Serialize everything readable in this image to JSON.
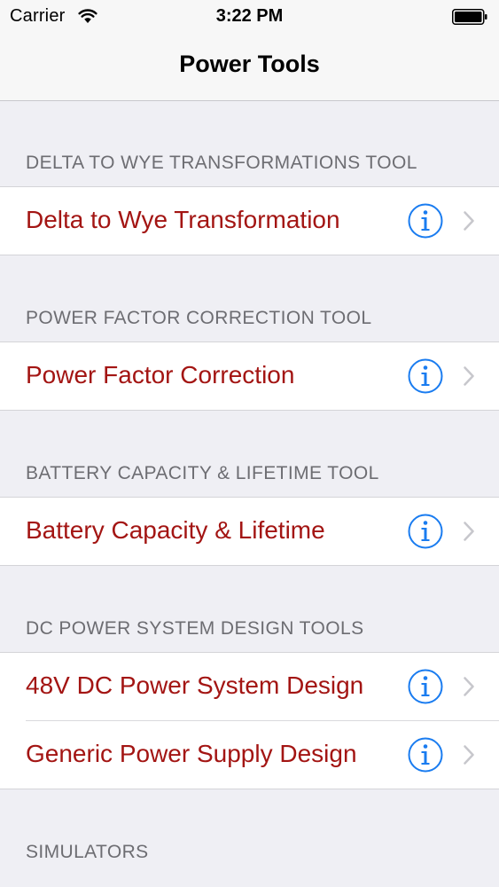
{
  "status_bar": {
    "carrier": "Carrier",
    "time": "3:22 PM"
  },
  "nav": {
    "title": "Power Tools"
  },
  "colors": {
    "accent_text": "#a31513",
    "info_blue": "#1a7cf0",
    "background": "#efeff4"
  },
  "sections": [
    {
      "header": "DELTA TO WYE TRANSFORMATIONS TOOL",
      "items": [
        {
          "label": "Delta to Wye Transformation",
          "icons": [
            "info-icon",
            "chevron-right-icon"
          ]
        }
      ]
    },
    {
      "header": "POWER FACTOR CORRECTION TOOL",
      "items": [
        {
          "label": "Power Factor Correction",
          "icons": [
            "info-icon",
            "chevron-right-icon"
          ]
        }
      ]
    },
    {
      "header": "BATTERY CAPACITY & LIFETIME TOOL",
      "items": [
        {
          "label": "Battery Capacity & Lifetime",
          "icons": [
            "info-icon",
            "chevron-right-icon"
          ]
        }
      ]
    },
    {
      "header": "DC POWER SYSTEM DESIGN TOOLS",
      "items": [
        {
          "label": "48V DC Power System Design",
          "icons": [
            "info-icon",
            "chevron-right-icon"
          ]
        },
        {
          "label": "Generic Power Supply Design",
          "icons": [
            "info-icon",
            "chevron-right-icon"
          ]
        }
      ]
    },
    {
      "header": "SIMULATORS",
      "items": []
    }
  ]
}
